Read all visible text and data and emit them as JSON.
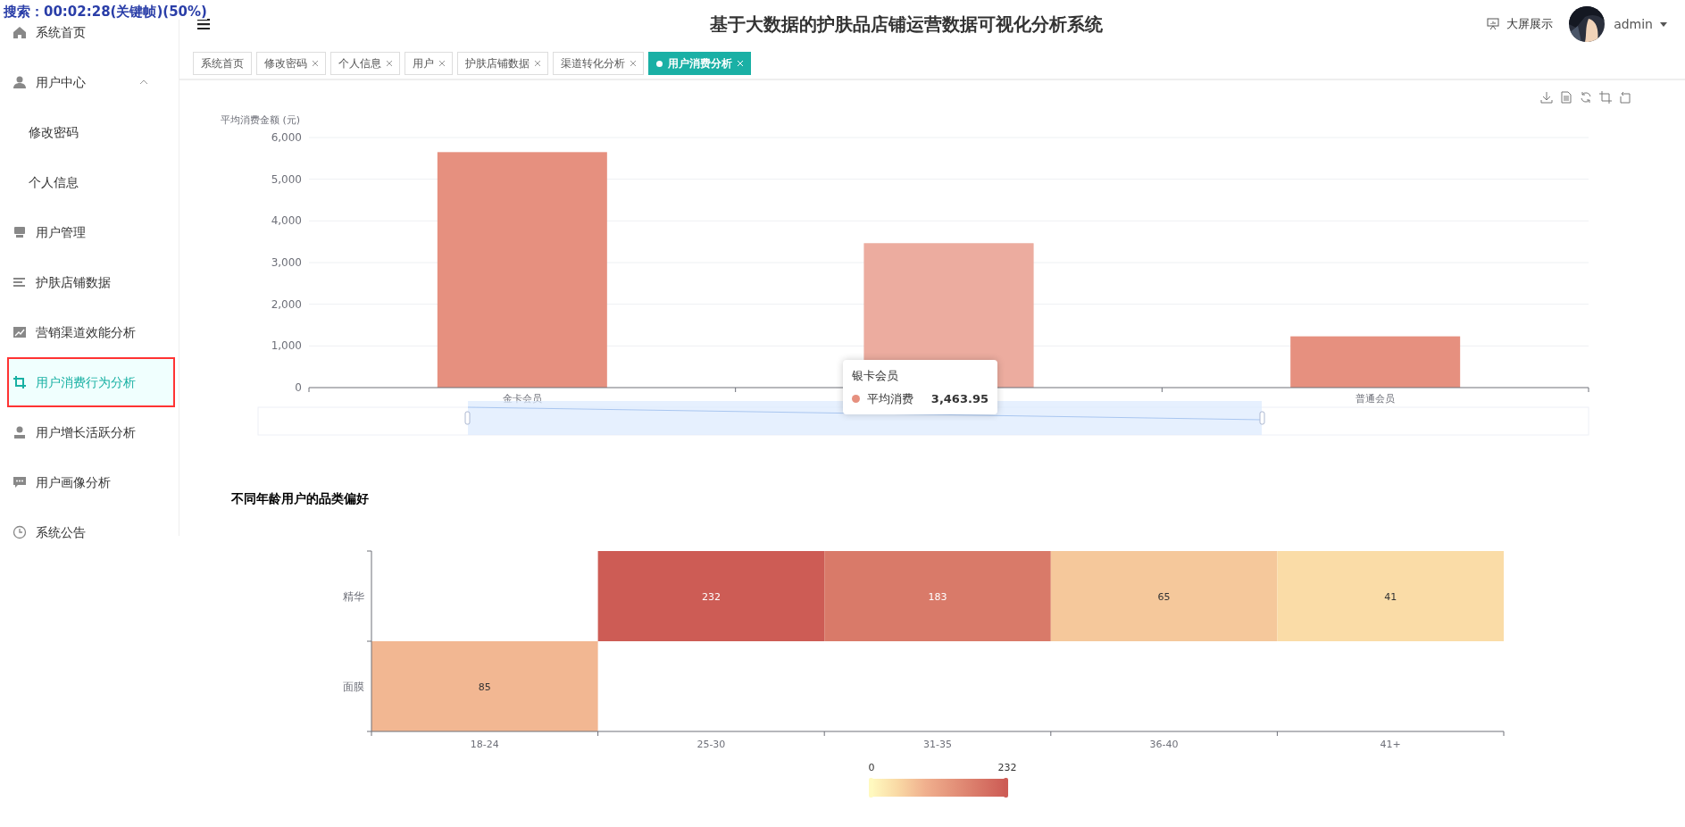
{
  "player_overlay": "搜索：00:02:28(关键帧)(50%)",
  "sidebar": {
    "items": [
      {
        "kind": "link",
        "label": "系统首页",
        "selected": false,
        "highlight_box": false
      },
      {
        "kind": "group",
        "label": "用户中心",
        "expanded": true,
        "children": [
          {
            "label": "修改密码",
            "selected": false
          },
          {
            "label": "个人信息",
            "selected": false
          }
        ]
      },
      {
        "kind": "link",
        "label": "用户管理",
        "selected": false,
        "highlight_box": false
      },
      {
        "kind": "link",
        "label": "护肤店铺数据",
        "selected": false,
        "highlight_box": false
      },
      {
        "kind": "link",
        "label": "营销渠道效能分析",
        "selected": false,
        "highlight_box": false
      },
      {
        "kind": "link",
        "label": "用户消费行为分析",
        "selected": true,
        "highlight_box": true
      },
      {
        "kind": "link",
        "label": "用户增长活跃分析",
        "selected": false,
        "highlight_box": false
      },
      {
        "kind": "link",
        "label": "用户画像分析",
        "selected": false,
        "highlight_box": false
      },
      {
        "kind": "link",
        "label": "系统公告",
        "selected": false,
        "highlight_box": false
      }
    ]
  },
  "header": {
    "title": "基于大数据的护肤品店铺运营数据可视化分析系统",
    "screen_link": "大屏展示",
    "user": "admin"
  },
  "tabs": [
    {
      "label": "系统首页",
      "closable": false,
      "selected": false
    },
    {
      "label": "修改密码",
      "closable": true,
      "selected": false
    },
    {
      "label": "个人信息",
      "closable": true,
      "selected": false
    },
    {
      "label": "用户",
      "closable": true,
      "selected": false
    },
    {
      "label": "护肤店铺数据",
      "closable": true,
      "selected": false
    },
    {
      "label": "渠道转化分析",
      "closable": true,
      "selected": false
    },
    {
      "label": "用户消费分析",
      "closable": true,
      "selected": true
    }
  ],
  "spending_chart": {
    "chart_data": {
      "type": "bar",
      "ylabel": "平均消费金额 (元)",
      "categories": [
        "金卡会员",
        null,
        "普通会员"
      ],
      "series": [
        {
          "name": "平均消费",
          "color": "#e6907f",
          "values": [
            5650,
            3463.95,
            1230
          ]
        }
      ],
      "ylim": [
        0,
        6000
      ],
      "grid": true,
      "yticks": [
        {
          "value": 0,
          "label": "0"
        },
        {
          "value": 1000,
          "label": "1,000"
        },
        {
          "value": 2000,
          "label": "2,000"
        },
        {
          "value": 3000,
          "label": "3,000"
        },
        {
          "value": 4000,
          "label": "4,000"
        },
        {
          "value": 5000,
          "label": "5,000"
        },
        {
          "value": 6000,
          "label": "6,000"
        }
      ]
    },
    "highlighted": [
      false,
      true,
      false
    ],
    "tooltip": {
      "title": "银卡会员",
      "value": "3,463.95"
    }
  },
  "heatmap": {
    "title": "不同年龄用户的品类偏好",
    "row_labels": [
      "精华",
      "面膜"
    ],
    "columns": [
      {
        "label": "18-24",
        "bottom_row": "85"
      },
      {
        "label": "25-30",
        "top_row": "232"
      },
      {
        "label": "31-35",
        "top_row": "183"
      },
      {
        "label": "36-40",
        "top_row": "65"
      },
      {
        "label": "41+",
        "top_row": "41"
      }
    ],
    "legend": {
      "min": "0",
      "max": "232"
    }
  }
}
